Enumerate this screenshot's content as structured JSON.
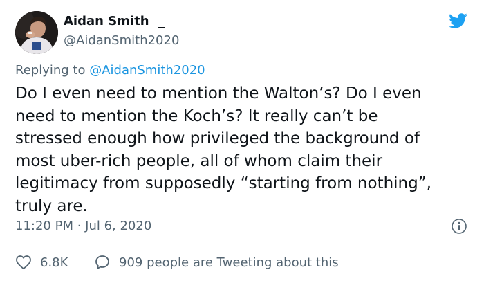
{
  "tweet": {
    "author_name": "Aidan Smith",
    "author_handle": "@AidanSmith2020",
    "replying_to_prefix": "Replying to ",
    "replying_to_handle": "@AidanSmith2020",
    "body_lines": [
      "Do I even need to mention the Walton’s? Do I even",
      "need to mention the Koch’s? It really can’t be",
      "stressed enough how privileged the background of",
      "most uber-rich people, all of whom claim their",
      "legitimacy from supposedly “starting from nothing”,",
      "truly are."
    ],
    "timestamp": "11:20 PM · Jul 6, 2020",
    "likes": "6.8K",
    "conversation_text": "909 people are Tweeting about this"
  },
  "icons": {
    "platform": "twitter-bird-icon",
    "info": "info-icon",
    "like": "heart-icon",
    "reply": "speech-bubble-icon"
  },
  "colors": {
    "brand": "#1da1f2",
    "link": "#1b95e0",
    "secondary_text": "#536471",
    "primary_text": "#0f1419"
  }
}
